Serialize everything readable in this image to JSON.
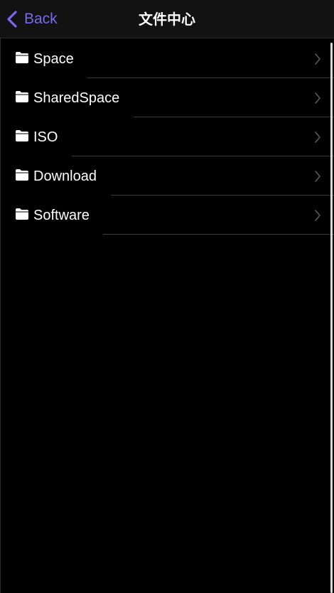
{
  "navbar": {
    "back_label": "Back",
    "title": "文件中心",
    "accent_color": "#7b68ee"
  },
  "folders": [
    {
      "label": "Space",
      "icon": "folder-icon"
    },
    {
      "label": "SharedSpace",
      "icon": "folder-icon"
    },
    {
      "label": "ISO",
      "icon": "folder-icon"
    },
    {
      "label": "Download",
      "icon": "folder-icon"
    },
    {
      "label": "Software",
      "icon": "folder-icon"
    }
  ]
}
